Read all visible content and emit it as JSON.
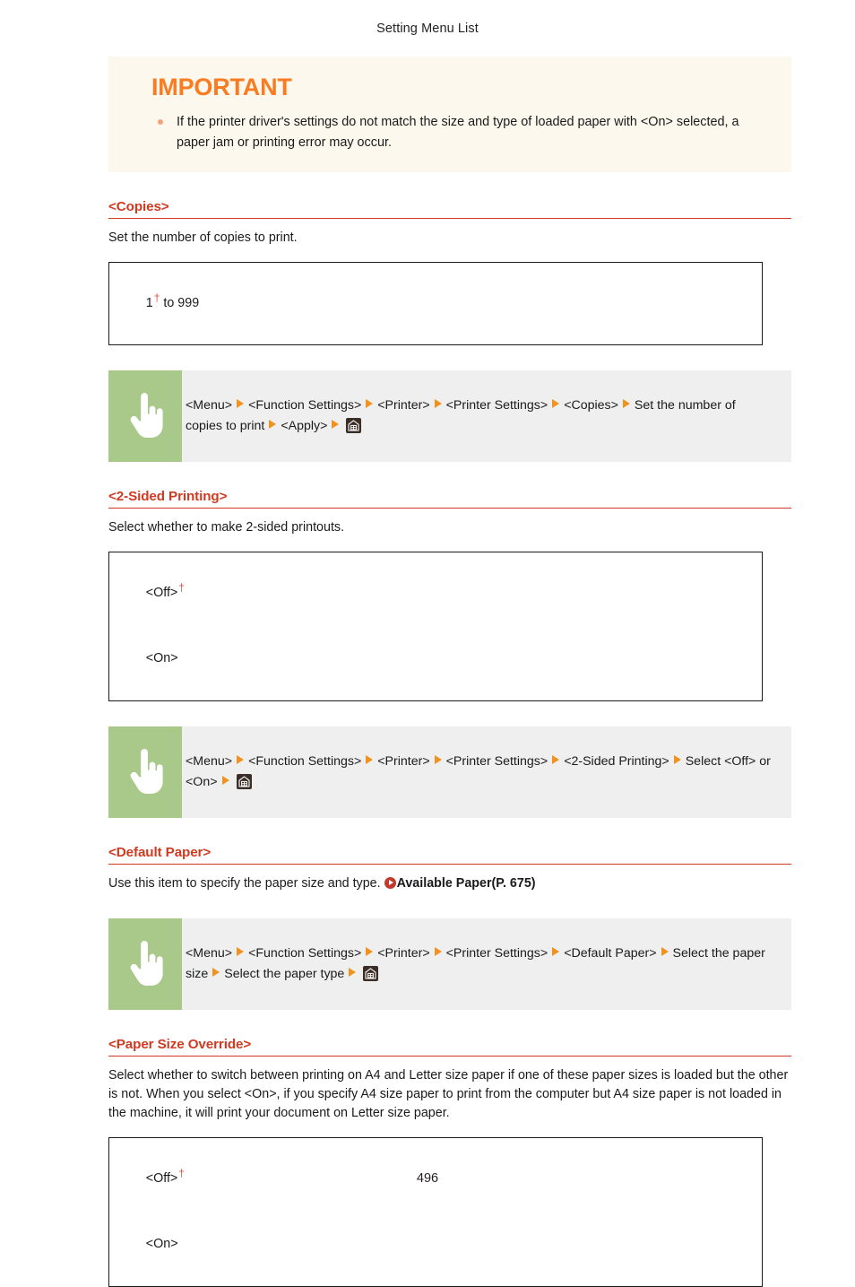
{
  "header": {
    "title": "Setting Menu List"
  },
  "footer": {
    "page_number": "496"
  },
  "important": {
    "title": "IMPORTANT",
    "items": [
      "If the printer driver's settings do not match the size and type of loaded paper with <On> selected, a paper jam or printing error may occur."
    ]
  },
  "sections": [
    {
      "title": "<Copies>",
      "description": "Set the number of copies to print.",
      "values": [
        {
          "text": "1",
          "dagger": true,
          "suffix": " to 999"
        }
      ],
      "nav": {
        "icon": "pointing-hand-icon",
        "steps": [
          "<Menu>",
          "<Function Settings>",
          "<Printer>",
          "<Printer Settings>",
          "<Copies>",
          "Set the number of copies to print",
          "<Apply>"
        ],
        "end_icon": "home-key-icon"
      }
    },
    {
      "title": "<2-Sided Printing>",
      "description": "Select whether to make 2-sided printouts.",
      "values": [
        {
          "text": "<Off>",
          "dagger": true,
          "suffix": ""
        },
        {
          "text": "<On>",
          "dagger": false,
          "suffix": ""
        }
      ],
      "nav": {
        "icon": "pointing-hand-icon",
        "steps": [
          "<Menu>",
          "<Function Settings>",
          "<Printer>",
          "<Printer Settings>",
          "<2-Sided Printing>",
          "Select <Off> or <On>"
        ],
        "end_icon": "home-key-icon"
      }
    },
    {
      "title": "<Default Paper>",
      "description": "Use this item to specify the paper size and type.",
      "reference": {
        "icon": "red-arrow-bullet-icon",
        "label": "Available Paper(P. 675)"
      },
      "values": [],
      "nav": {
        "icon": "pointing-hand-icon",
        "steps": [
          "<Menu>",
          "<Function Settings>",
          "<Printer>",
          "<Printer Settings>",
          "<Default Paper>",
          "Select the paper size",
          "Select the paper type"
        ],
        "end_icon": "home-key-icon"
      }
    },
    {
      "title": "<Paper Size Override>",
      "description": "Select whether to switch between printing on A4 and Letter size paper if one of these paper sizes is loaded but the other is not. When you select <On>, if you specify A4 size paper to print from the computer but A4 size paper is not loaded in the machine, it will print your document on Letter size paper.",
      "values": [
        {
          "text": "<Off>",
          "dagger": true,
          "suffix": ""
        },
        {
          "text": "<On>",
          "dagger": false,
          "suffix": ""
        }
      ],
      "nav": null
    }
  ],
  "colors": {
    "section_heading": "#cf3a21",
    "important_heading": "#f97c22",
    "important_background": "#fdf8ed",
    "nav_icon_pane": "#a8c98a",
    "nav_background": "#efefef",
    "arrow": "#f0921e",
    "dagger": "#e2523a",
    "reference_bullet": "#c0392b"
  }
}
